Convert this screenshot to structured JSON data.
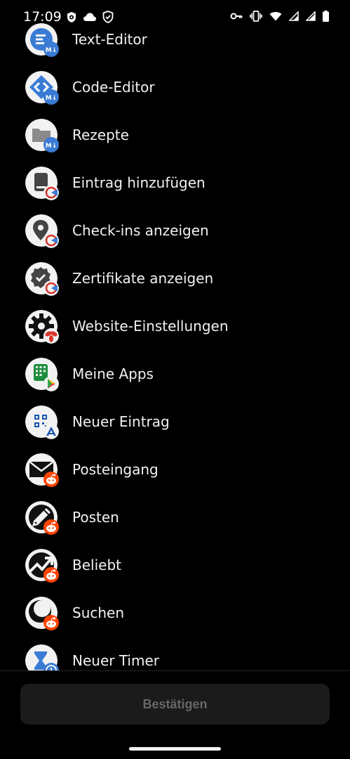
{
  "status_bar": {
    "time": "17:09"
  },
  "apps": [
    {
      "label": "Text-Editor",
      "icon": "text-editor-icon",
      "badge": "markor-badge-icon"
    },
    {
      "label": "Code-Editor",
      "icon": "code-editor-icon",
      "badge": "markor-badge-icon"
    },
    {
      "label": "Rezepte",
      "icon": "folder-icon",
      "badge": "markor-badge-icon"
    },
    {
      "label": "Eintrag hinzufügen",
      "icon": "add-entry-icon",
      "badge": "covid-cert-badge-icon"
    },
    {
      "label": "Check-ins anzeigen",
      "icon": "location-pin-icon",
      "badge": "covid-cert-badge-icon"
    },
    {
      "label": "Zertifikate anzeigen",
      "icon": "verified-seal-icon",
      "badge": "covid-cert-badge-icon"
    },
    {
      "label": "Website-Einstellungen",
      "icon": "gear-icon",
      "badge": "browser-badge-icon"
    },
    {
      "label": "Meine Apps",
      "icon": "apps-grid-icon",
      "badge": "play-store-badge-icon"
    },
    {
      "label": "Neuer Eintrag",
      "icon": "qr-code-icon",
      "badge": "app-badge-icon"
    },
    {
      "label": "Posteingang",
      "icon": "mail-icon",
      "badge": "reddit-badge-icon"
    },
    {
      "label": "Posten",
      "icon": "pencil-icon",
      "badge": "reddit-badge-icon"
    },
    {
      "label": "Beliebt",
      "icon": "trending-icon",
      "badge": "reddit-badge-icon"
    },
    {
      "label": "Suchen",
      "icon": "search-icon",
      "badge": "reddit-badge-icon"
    },
    {
      "label": "Neuer Timer",
      "icon": "hourglass-icon",
      "badge": "clock-badge-icon"
    }
  ],
  "confirm_button": {
    "label": "Bestätigen"
  },
  "colors": {
    "background": "#000000",
    "icon_bg": "#f2f2f2",
    "markor_blue": "#3a7bd5",
    "reddit_orange": "#ff4500",
    "cert_red": "#d9342b",
    "button_bg": "#1b1b1b",
    "button_text": "#666666"
  }
}
